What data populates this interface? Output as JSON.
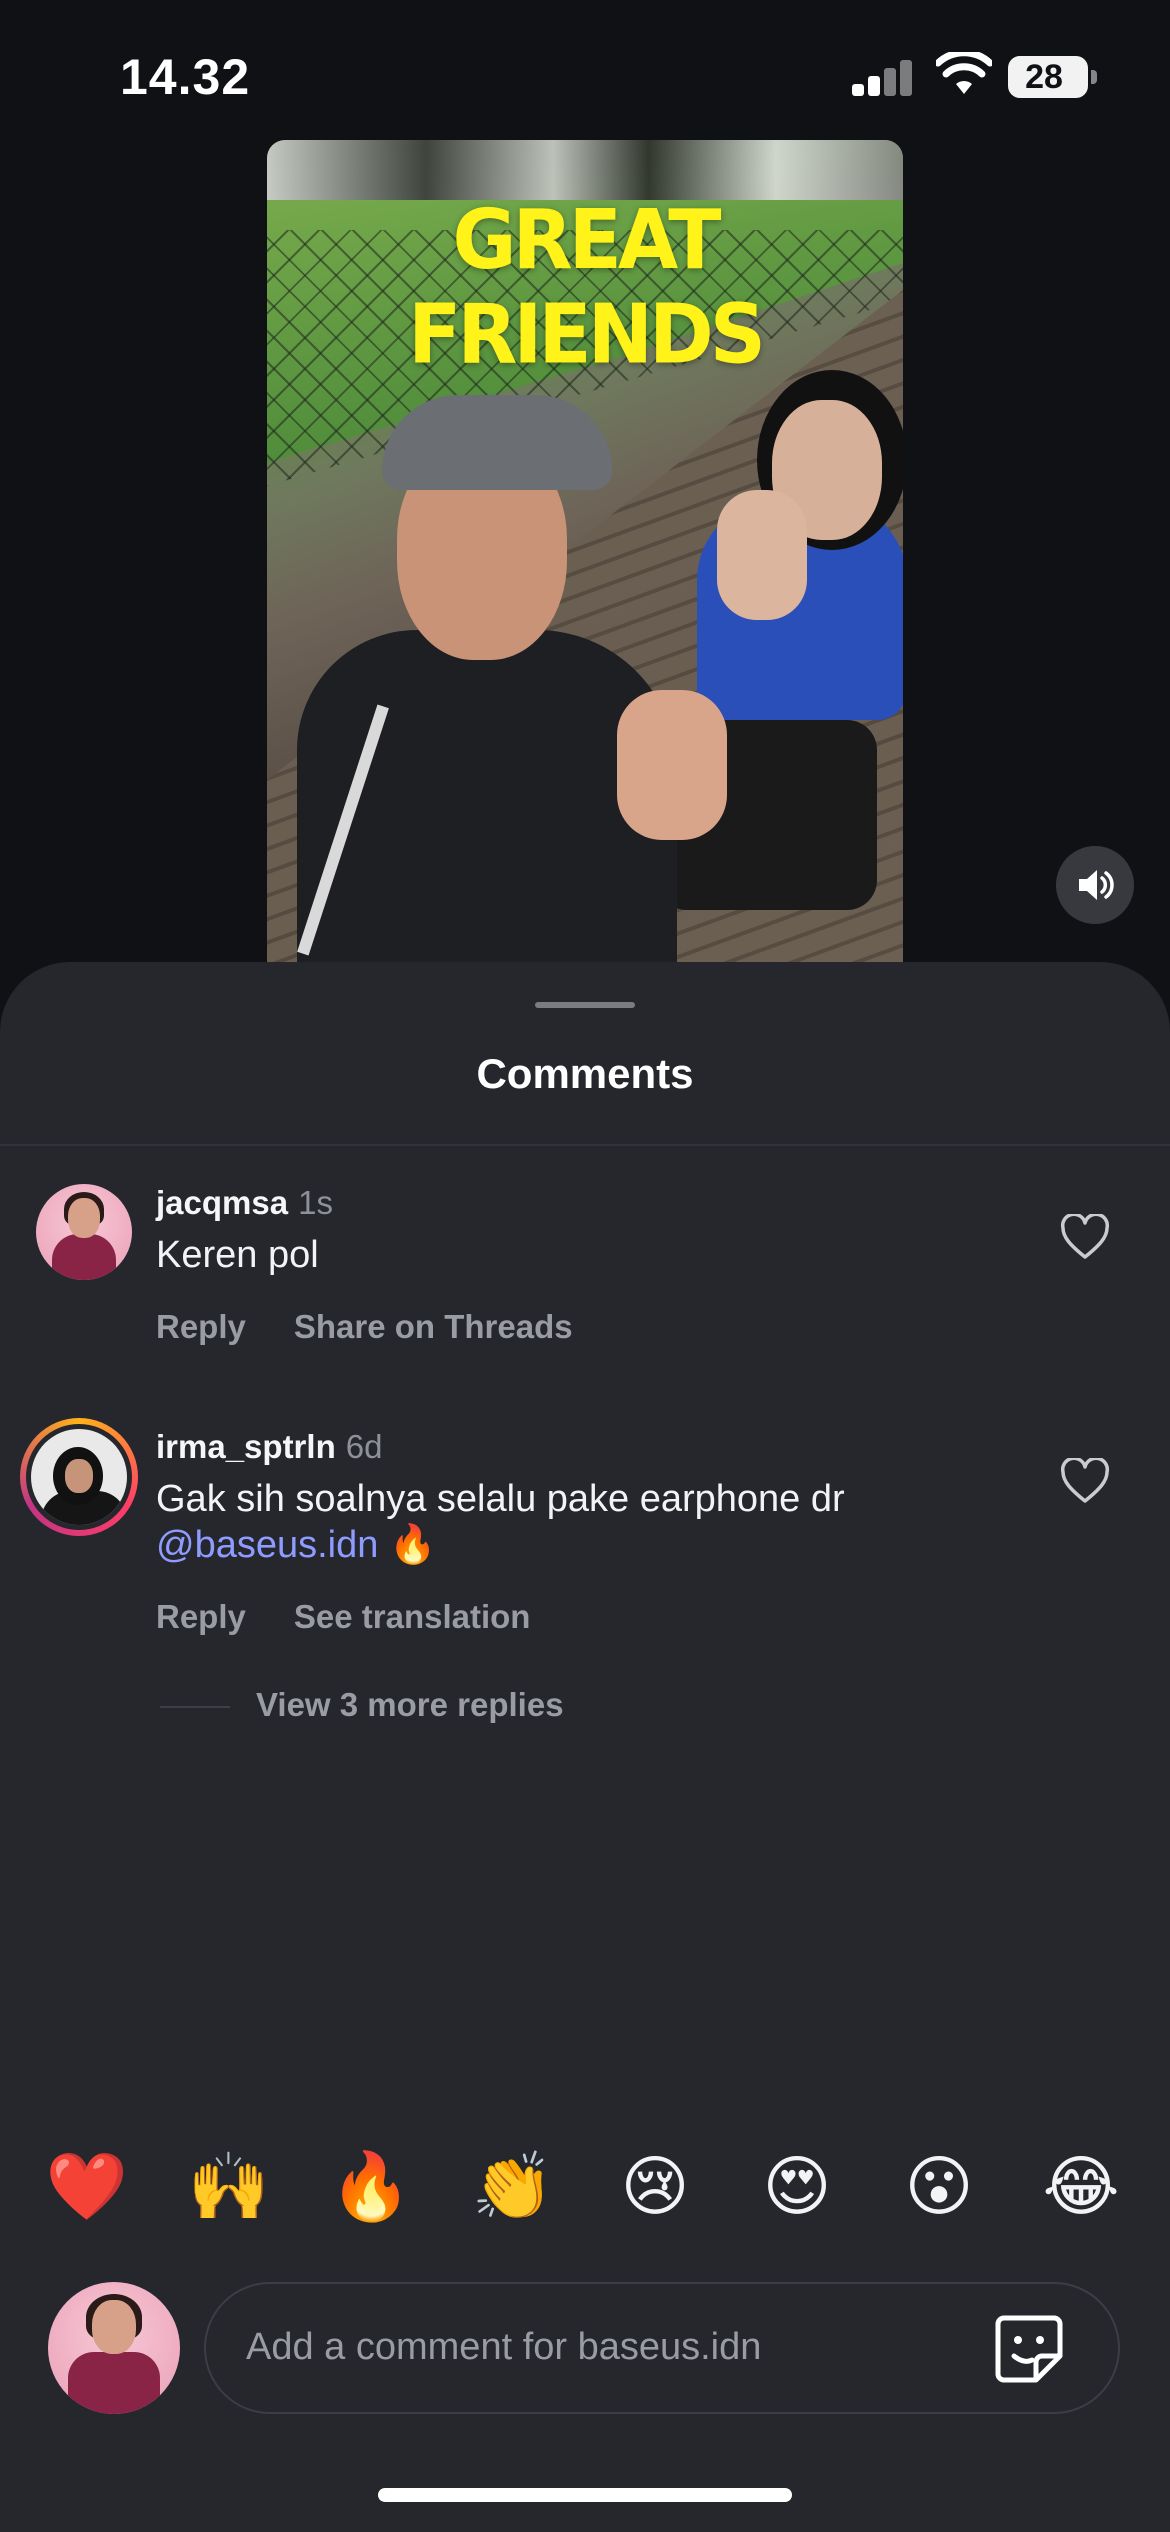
{
  "status_bar": {
    "time": "14.32",
    "battery": "28"
  },
  "media": {
    "headline": "GREAT FRIENDS"
  },
  "sheet": {
    "title": "Comments"
  },
  "comments": [
    {
      "username": "jacqmsa",
      "age": "1s",
      "text": "Keren pol",
      "actions": [
        "Reply",
        "Share on Threads"
      ]
    },
    {
      "username": "irma_sptrln",
      "age": "6d",
      "text": "Gak sih soalnya selalu pake earphone dr",
      "mention": "@baseus.idn",
      "emoji": "🔥",
      "actions": [
        "Reply",
        "See translation"
      ],
      "more_replies": "View 3 more replies"
    }
  ],
  "quick_reactions": [
    "❤️",
    "🙌",
    "🔥",
    "👏",
    "😢",
    "😍",
    "😮",
    "😂"
  ],
  "composer": {
    "placeholder": "Add a comment for baseus.idn"
  },
  "icons": [
    "signal-icon",
    "wifi-icon",
    "battery-icon",
    "sound-icon",
    "heart-icon",
    "sticker-icon"
  ]
}
